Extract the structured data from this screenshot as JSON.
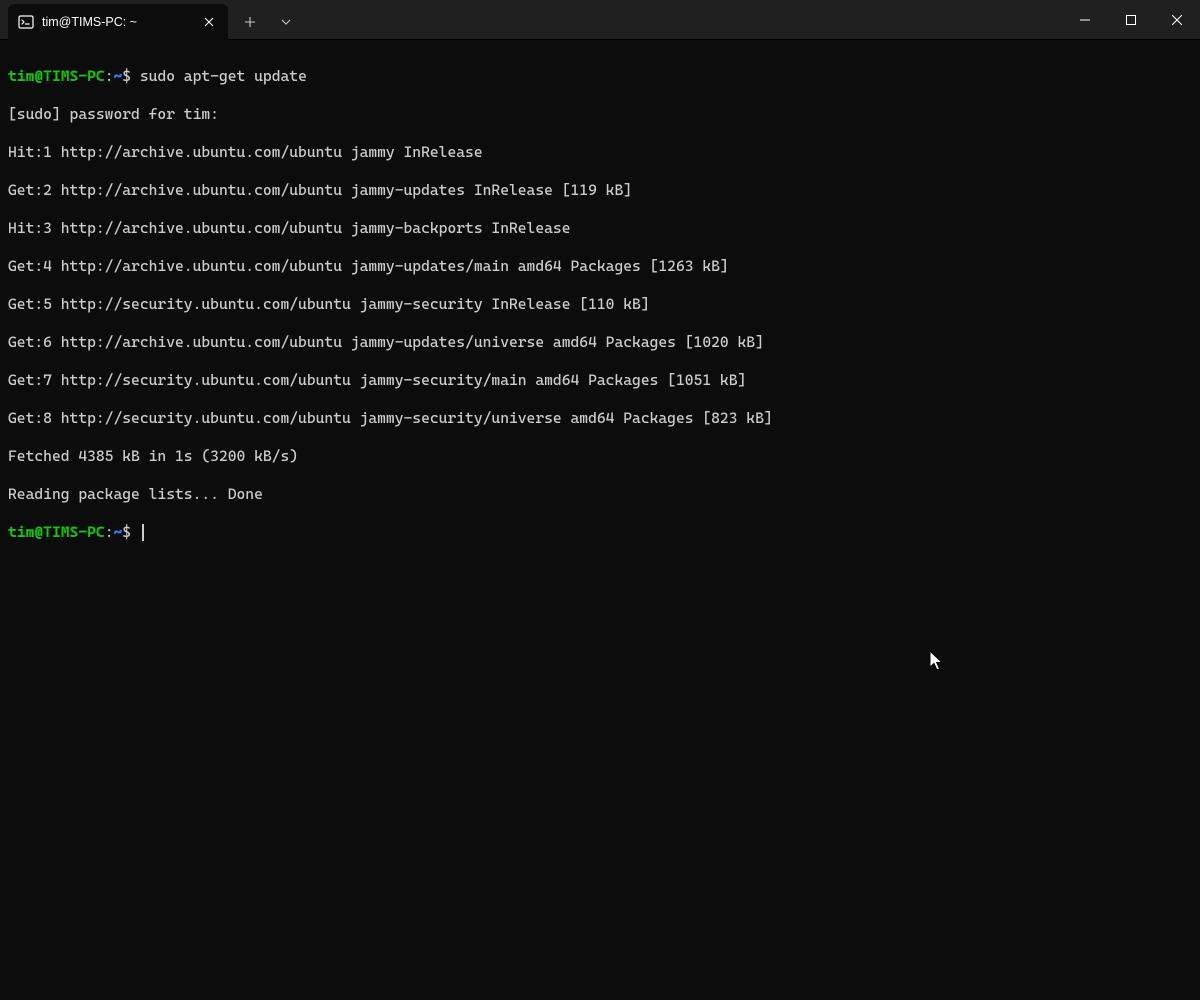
{
  "titlebar": {
    "tab": {
      "title": "tim@TIMS-PC: ~"
    },
    "new_tab_tooltip": "New Tab",
    "dropdown_tooltip": "Open a new tab"
  },
  "prompt1": {
    "user": "tim@TIMS-PC",
    "colon": ":",
    "path": "~",
    "dollar": "$ ",
    "command": "sudo apt-get update"
  },
  "output": [
    "[sudo] password for tim:",
    "Hit:1 http://archive.ubuntu.com/ubuntu jammy InRelease",
    "Get:2 http://archive.ubuntu.com/ubuntu jammy-updates InRelease [119 kB]",
    "Hit:3 http://archive.ubuntu.com/ubuntu jammy-backports InRelease",
    "Get:4 http://archive.ubuntu.com/ubuntu jammy-updates/main amd64 Packages [1263 kB]",
    "Get:5 http://security.ubuntu.com/ubuntu jammy-security InRelease [110 kB]",
    "Get:6 http://archive.ubuntu.com/ubuntu jammy-updates/universe amd64 Packages [1020 kB]",
    "Get:7 http://security.ubuntu.com/ubuntu jammy-security/main amd64 Packages [1051 kB]",
    "Get:8 http://security.ubuntu.com/ubuntu jammy-security/universe amd64 Packages [823 kB]",
    "Fetched 4385 kB in 1s (3200 kB/s)",
    "Reading package lists... Done"
  ],
  "prompt2": {
    "user": "tim@TIMS-PC",
    "colon": ":",
    "path": "~",
    "dollar": "$ "
  }
}
